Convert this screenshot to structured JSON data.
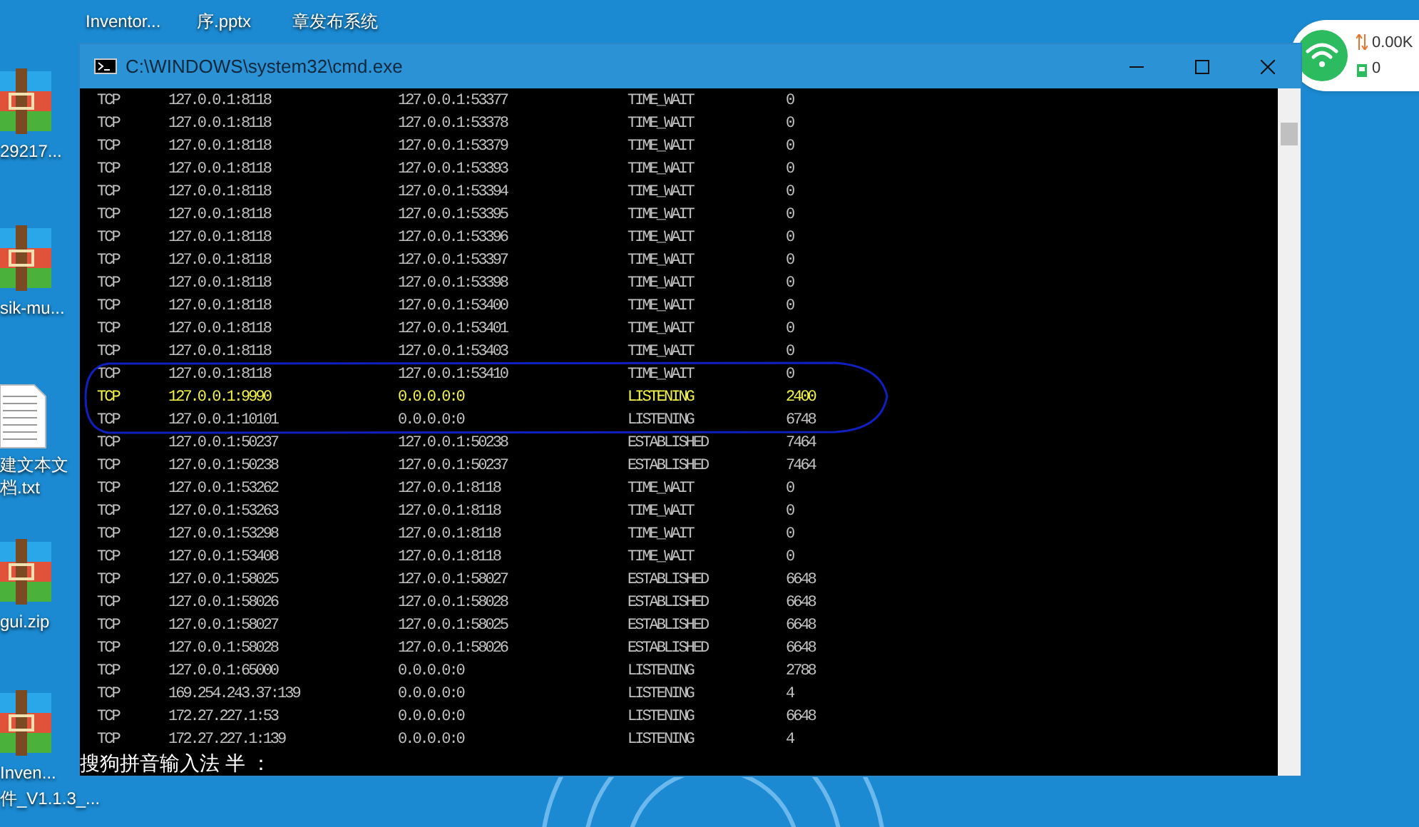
{
  "desktop": {
    "top_labels": [
      "Inventor...",
      "序.pptx",
      "章发布系统"
    ],
    "left_icons": [
      {
        "kind": "archive",
        "label": "29217..."
      },
      {
        "kind": "archive",
        "label": "sik-mu..."
      },
      {
        "kind": "text",
        "label": "建文本文档.txt"
      },
      {
        "kind": "archive",
        "label": "gui.zip"
      },
      {
        "kind": "archive",
        "label": "Inven..."
      }
    ],
    "bottom_label": "件_V1.1.3_..."
  },
  "window": {
    "title": "C:\\WINDOWS\\system32\\cmd.exe",
    "rows": [
      {
        "proto": "TCP",
        "local": "127.0.0.1:8118",
        "foreign": "127.0.0.1:53377",
        "state": "TIME_WAIT",
        "pid": "0",
        "highlighted": false
      },
      {
        "proto": "TCP",
        "local": "127.0.0.1:8118",
        "foreign": "127.0.0.1:53378",
        "state": "TIME_WAIT",
        "pid": "0",
        "highlighted": false
      },
      {
        "proto": "TCP",
        "local": "127.0.0.1:8118",
        "foreign": "127.0.0.1:53379",
        "state": "TIME_WAIT",
        "pid": "0",
        "highlighted": false
      },
      {
        "proto": "TCP",
        "local": "127.0.0.1:8118",
        "foreign": "127.0.0.1:53393",
        "state": "TIME_WAIT",
        "pid": "0",
        "highlighted": false
      },
      {
        "proto": "TCP",
        "local": "127.0.0.1:8118",
        "foreign": "127.0.0.1:53394",
        "state": "TIME_WAIT",
        "pid": "0",
        "highlighted": false
      },
      {
        "proto": "TCP",
        "local": "127.0.0.1:8118",
        "foreign": "127.0.0.1:53395",
        "state": "TIME_WAIT",
        "pid": "0",
        "highlighted": false
      },
      {
        "proto": "TCP",
        "local": "127.0.0.1:8118",
        "foreign": "127.0.0.1:53396",
        "state": "TIME_WAIT",
        "pid": "0",
        "highlighted": false
      },
      {
        "proto": "TCP",
        "local": "127.0.0.1:8118",
        "foreign": "127.0.0.1:53397",
        "state": "TIME_WAIT",
        "pid": "0",
        "highlighted": false
      },
      {
        "proto": "TCP",
        "local": "127.0.0.1:8118",
        "foreign": "127.0.0.1:53398",
        "state": "TIME_WAIT",
        "pid": "0",
        "highlighted": false
      },
      {
        "proto": "TCP",
        "local": "127.0.0.1:8118",
        "foreign": "127.0.0.1:53400",
        "state": "TIME_WAIT",
        "pid": "0",
        "highlighted": false
      },
      {
        "proto": "TCP",
        "local": "127.0.0.1:8118",
        "foreign": "127.0.0.1:53401",
        "state": "TIME_WAIT",
        "pid": "0",
        "highlighted": false
      },
      {
        "proto": "TCP",
        "local": "127.0.0.1:8118",
        "foreign": "127.0.0.1:53403",
        "state": "TIME_WAIT",
        "pid": "0",
        "highlighted": false
      },
      {
        "proto": "TCP",
        "local": "127.0.0.1:8118",
        "foreign": "127.0.0.1:53410",
        "state": "TIME_WAIT",
        "pid": "0",
        "highlighted": false
      },
      {
        "proto": "TCP",
        "local": "127.0.0.1:9990",
        "foreign": "0.0.0.0:0",
        "state": "LISTENING",
        "pid": "2400",
        "highlighted": true
      },
      {
        "proto": "TCP",
        "local": "127.0.0.1:10101",
        "foreign": "0.0.0.0:0",
        "state": "LISTENING",
        "pid": "6748",
        "highlighted": false
      },
      {
        "proto": "TCP",
        "local": "127.0.0.1:50237",
        "foreign": "127.0.0.1:50238",
        "state": "ESTABLISHED",
        "pid": "7464",
        "highlighted": false
      },
      {
        "proto": "TCP",
        "local": "127.0.0.1:50238",
        "foreign": "127.0.0.1:50237",
        "state": "ESTABLISHED",
        "pid": "7464",
        "highlighted": false
      },
      {
        "proto": "TCP",
        "local": "127.0.0.1:53262",
        "foreign": "127.0.0.1:8118",
        "state": "TIME_WAIT",
        "pid": "0",
        "highlighted": false
      },
      {
        "proto": "TCP",
        "local": "127.0.0.1:53263",
        "foreign": "127.0.0.1:8118",
        "state": "TIME_WAIT",
        "pid": "0",
        "highlighted": false
      },
      {
        "proto": "TCP",
        "local": "127.0.0.1:53298",
        "foreign": "127.0.0.1:8118",
        "state": "TIME_WAIT",
        "pid": "0",
        "highlighted": false
      },
      {
        "proto": "TCP",
        "local": "127.0.0.1:53408",
        "foreign": "127.0.0.1:8118",
        "state": "TIME_WAIT",
        "pid": "0",
        "highlighted": false
      },
      {
        "proto": "TCP",
        "local": "127.0.0.1:58025",
        "foreign": "127.0.0.1:58027",
        "state": "ESTABLISHED",
        "pid": "6648",
        "highlighted": false
      },
      {
        "proto": "TCP",
        "local": "127.0.0.1:58026",
        "foreign": "127.0.0.1:58028",
        "state": "ESTABLISHED",
        "pid": "6648",
        "highlighted": false
      },
      {
        "proto": "TCP",
        "local": "127.0.0.1:58027",
        "foreign": "127.0.0.1:58025",
        "state": "ESTABLISHED",
        "pid": "6648",
        "highlighted": false
      },
      {
        "proto": "TCP",
        "local": "127.0.0.1:58028",
        "foreign": "127.0.0.1:58026",
        "state": "ESTABLISHED",
        "pid": "6648",
        "highlighted": false
      },
      {
        "proto": "TCP",
        "local": "127.0.0.1:65000",
        "foreign": "0.0.0.0:0",
        "state": "LISTENING",
        "pid": "2788",
        "highlighted": false
      },
      {
        "proto": "TCP",
        "local": "169.254.243.37:139",
        "foreign": "0.0.0.0:0",
        "state": "LISTENING",
        "pid": "4",
        "highlighted": false
      },
      {
        "proto": "TCP",
        "local": "172.27.227.1:53",
        "foreign": "0.0.0.0:0",
        "state": "LISTENING",
        "pid": "6648",
        "highlighted": false
      },
      {
        "proto": "TCP",
        "local": "172.27.227.1:139",
        "foreign": "0.0.0.0:0",
        "state": "LISTENING",
        "pid": "4",
        "highlighted": false
      }
    ],
    "ime_status": "搜狗拼音输入法 半 ："
  },
  "network_widget": {
    "speed": "0.00K",
    "count": "0"
  }
}
